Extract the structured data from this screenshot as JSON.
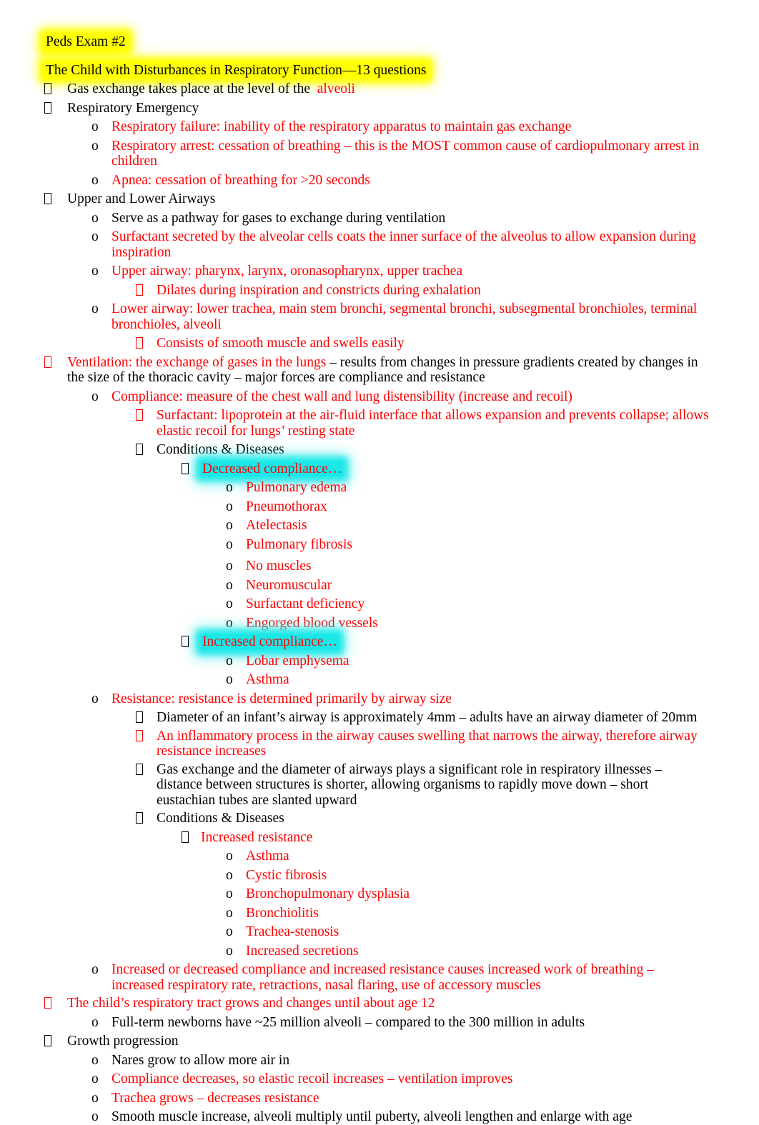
{
  "document": {
    "header": "Peds Exam #2",
    "section_title": "The Child with Disturbances in Respiratory Function—13 questions",
    "colors": {
      "body_text": "#000000",
      "emphasis_text": "#FF0000",
      "highlight_yellow": "#FFFF00",
      "highlight_cyan": "#19E8E8",
      "page_background": "#FFFFFF"
    },
    "markers": {
      "level1": "box-bullet",
      "level2": "o",
      "level3": "box-bullet",
      "level4": "box-bullet",
      "level5": "o"
    }
  },
  "outline": {
    "gas_exchange": "Gas exchange takes place at the level of the",
    "gas_exchange_emph": "alveoli",
    "respiratory_emergency": "Respiratory Emergency",
    "respiratory_failure": "Respiratory failure:  inability of the respiratory apparatus to maintain gas exchange",
    "respiratory_arrest": "Respiratory arrest:  cessation of breathing – this is the MOST common cause of cardiopulmonary arrest in children",
    "apnea": "Apnea: cessation of breathing for >20 seconds",
    "upper_lower_airways": "Upper and Lower Airways",
    "pathway": "Serve as a pathway for gases to exchange during ventilation",
    "surfactant_secreted": "Surfactant secreted by the alveolar cells coats the inner surface of the alveolus to allow expansion during inspiration",
    "upper_airway": "Upper airway:  pharynx, larynx, oronasopharynx, upper trachea",
    "dilates": "Dilates during inspiration and constricts during exhalation",
    "lower_airway": "Lower airway: lower trachea, main stem bronchi, segmental bronchi, subsegmental bronchioles, terminal bronchioles, alveoli",
    "smooth_muscle": "Consists of smooth muscle and swells easily",
    "ventilation_emph": "Ventilation:  the exchange of gases in the lungs",
    "ventilation_rest": "– results from changes in pressure gradients created by changes in the size of the thoracic cavity – major forces are compliance and resistance",
    "compliance": "Compliance: measure of the chest wall and lung distensibility (increase and recoil)",
    "surfactant_def": "Surfactant:  lipoprotein at the air-fluid interface that allows expansion and prevents collapse; allows elastic recoil for lungs’ resting state",
    "conditions_diseases_1": "Conditions & Diseases",
    "decreased_compliance": "Decreased compliance…",
    "decreased_compliance_items": [
      "Pulmonary edema",
      "Pneumothorax",
      "Atelectasis",
      "Pulmonary fibrosis",
      "No muscles",
      "Neuromuscular",
      "Surfactant deficiency",
      "Engorged blood vessels"
    ],
    "increased_compliance": "Increased compliance…",
    "increased_compliance_items": [
      "Lobar emphysema",
      "Asthma"
    ],
    "resistance": "Resistance: resistance is determined primarily by airway size",
    "diameter": "Diameter of an infant’s airway is approximately 4mm – adults have an airway diameter of 20mm",
    "inflammatory": "An inflammatory process in the airway causes swelling that narrows the airway, therefore airway resistance increases",
    "gas_exchange_diameter": "Gas exchange and the diameter of airways plays a significant role in respiratory illnesses – distance between structures is shorter, allowing organisms to rapidly move down – short eustachian tubes are slanted upward",
    "conditions_diseases_2": "Conditions & Diseases",
    "increased_resistance": "Increased resistance",
    "increased_resistance_items": [
      "Asthma",
      "Cystic fibrosis",
      "Bronchopulmonary dysplasia",
      "Bronchiolitis",
      "Trachea-stenosis",
      "Increased secretions"
    ],
    "work_of_breathing": "Increased or decreased compliance and increased resistance causes increased work of breathing – increased respiratory rate, retractions, nasal flaring, use of accessory muscles",
    "tract_grows": "The child’s respiratory tract grows and changes until about age 12",
    "newborn_alveoli": "Full-term newborns have ~25 million alveoli – compared to the 300 million in adults",
    "growth_progression": "Growth progression",
    "growth_items": [
      {
        "text": "Nares grow to allow more air in",
        "color": "black"
      },
      {
        "text": "Compliance decreases, so elastic recoil increases – ventilation improves",
        "color": "red"
      },
      {
        "text": "Trachea grows – decreases resistance",
        "color": "red"
      },
      {
        "text": "Smooth muscle increase, alveoli multiply until puberty, alveoli lengthen and enlarge with age",
        "color": "black"
      }
    ]
  }
}
